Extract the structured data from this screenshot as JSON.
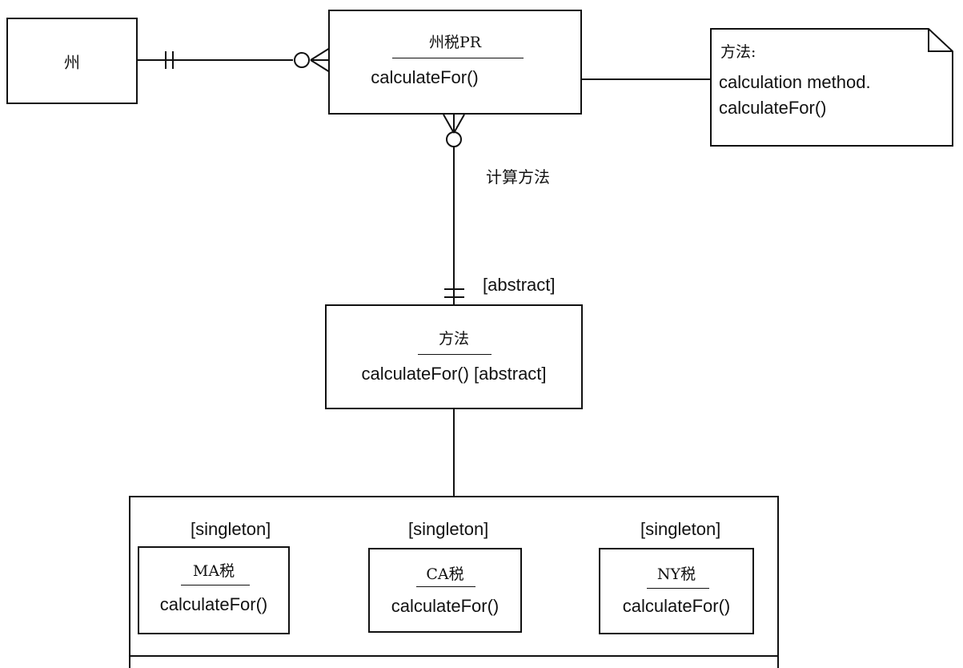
{
  "entities": {
    "state": {
      "title": "州"
    },
    "state_tax_pr": {
      "title": "州税PR",
      "method": "calculateFor()"
    },
    "method_class": {
      "title": "方法",
      "method": "calculateFor() [abstract]"
    },
    "ma_tax": {
      "stereotype": "[singleton]",
      "title": "MA税",
      "method": "calculateFor()"
    },
    "ca_tax": {
      "stereotype": "[singleton]",
      "title": "CA税",
      "method": "calculateFor()"
    },
    "ny_tax": {
      "stereotype": "[singleton]",
      "title": "NY税",
      "method": "calculateFor()"
    }
  },
  "note": {
    "heading": "方法:",
    "line1": "calculation method.",
    "line2": "calculateFor()"
  },
  "labels": {
    "relationship": "计算方法",
    "abstract_marker": "[abstract]"
  }
}
